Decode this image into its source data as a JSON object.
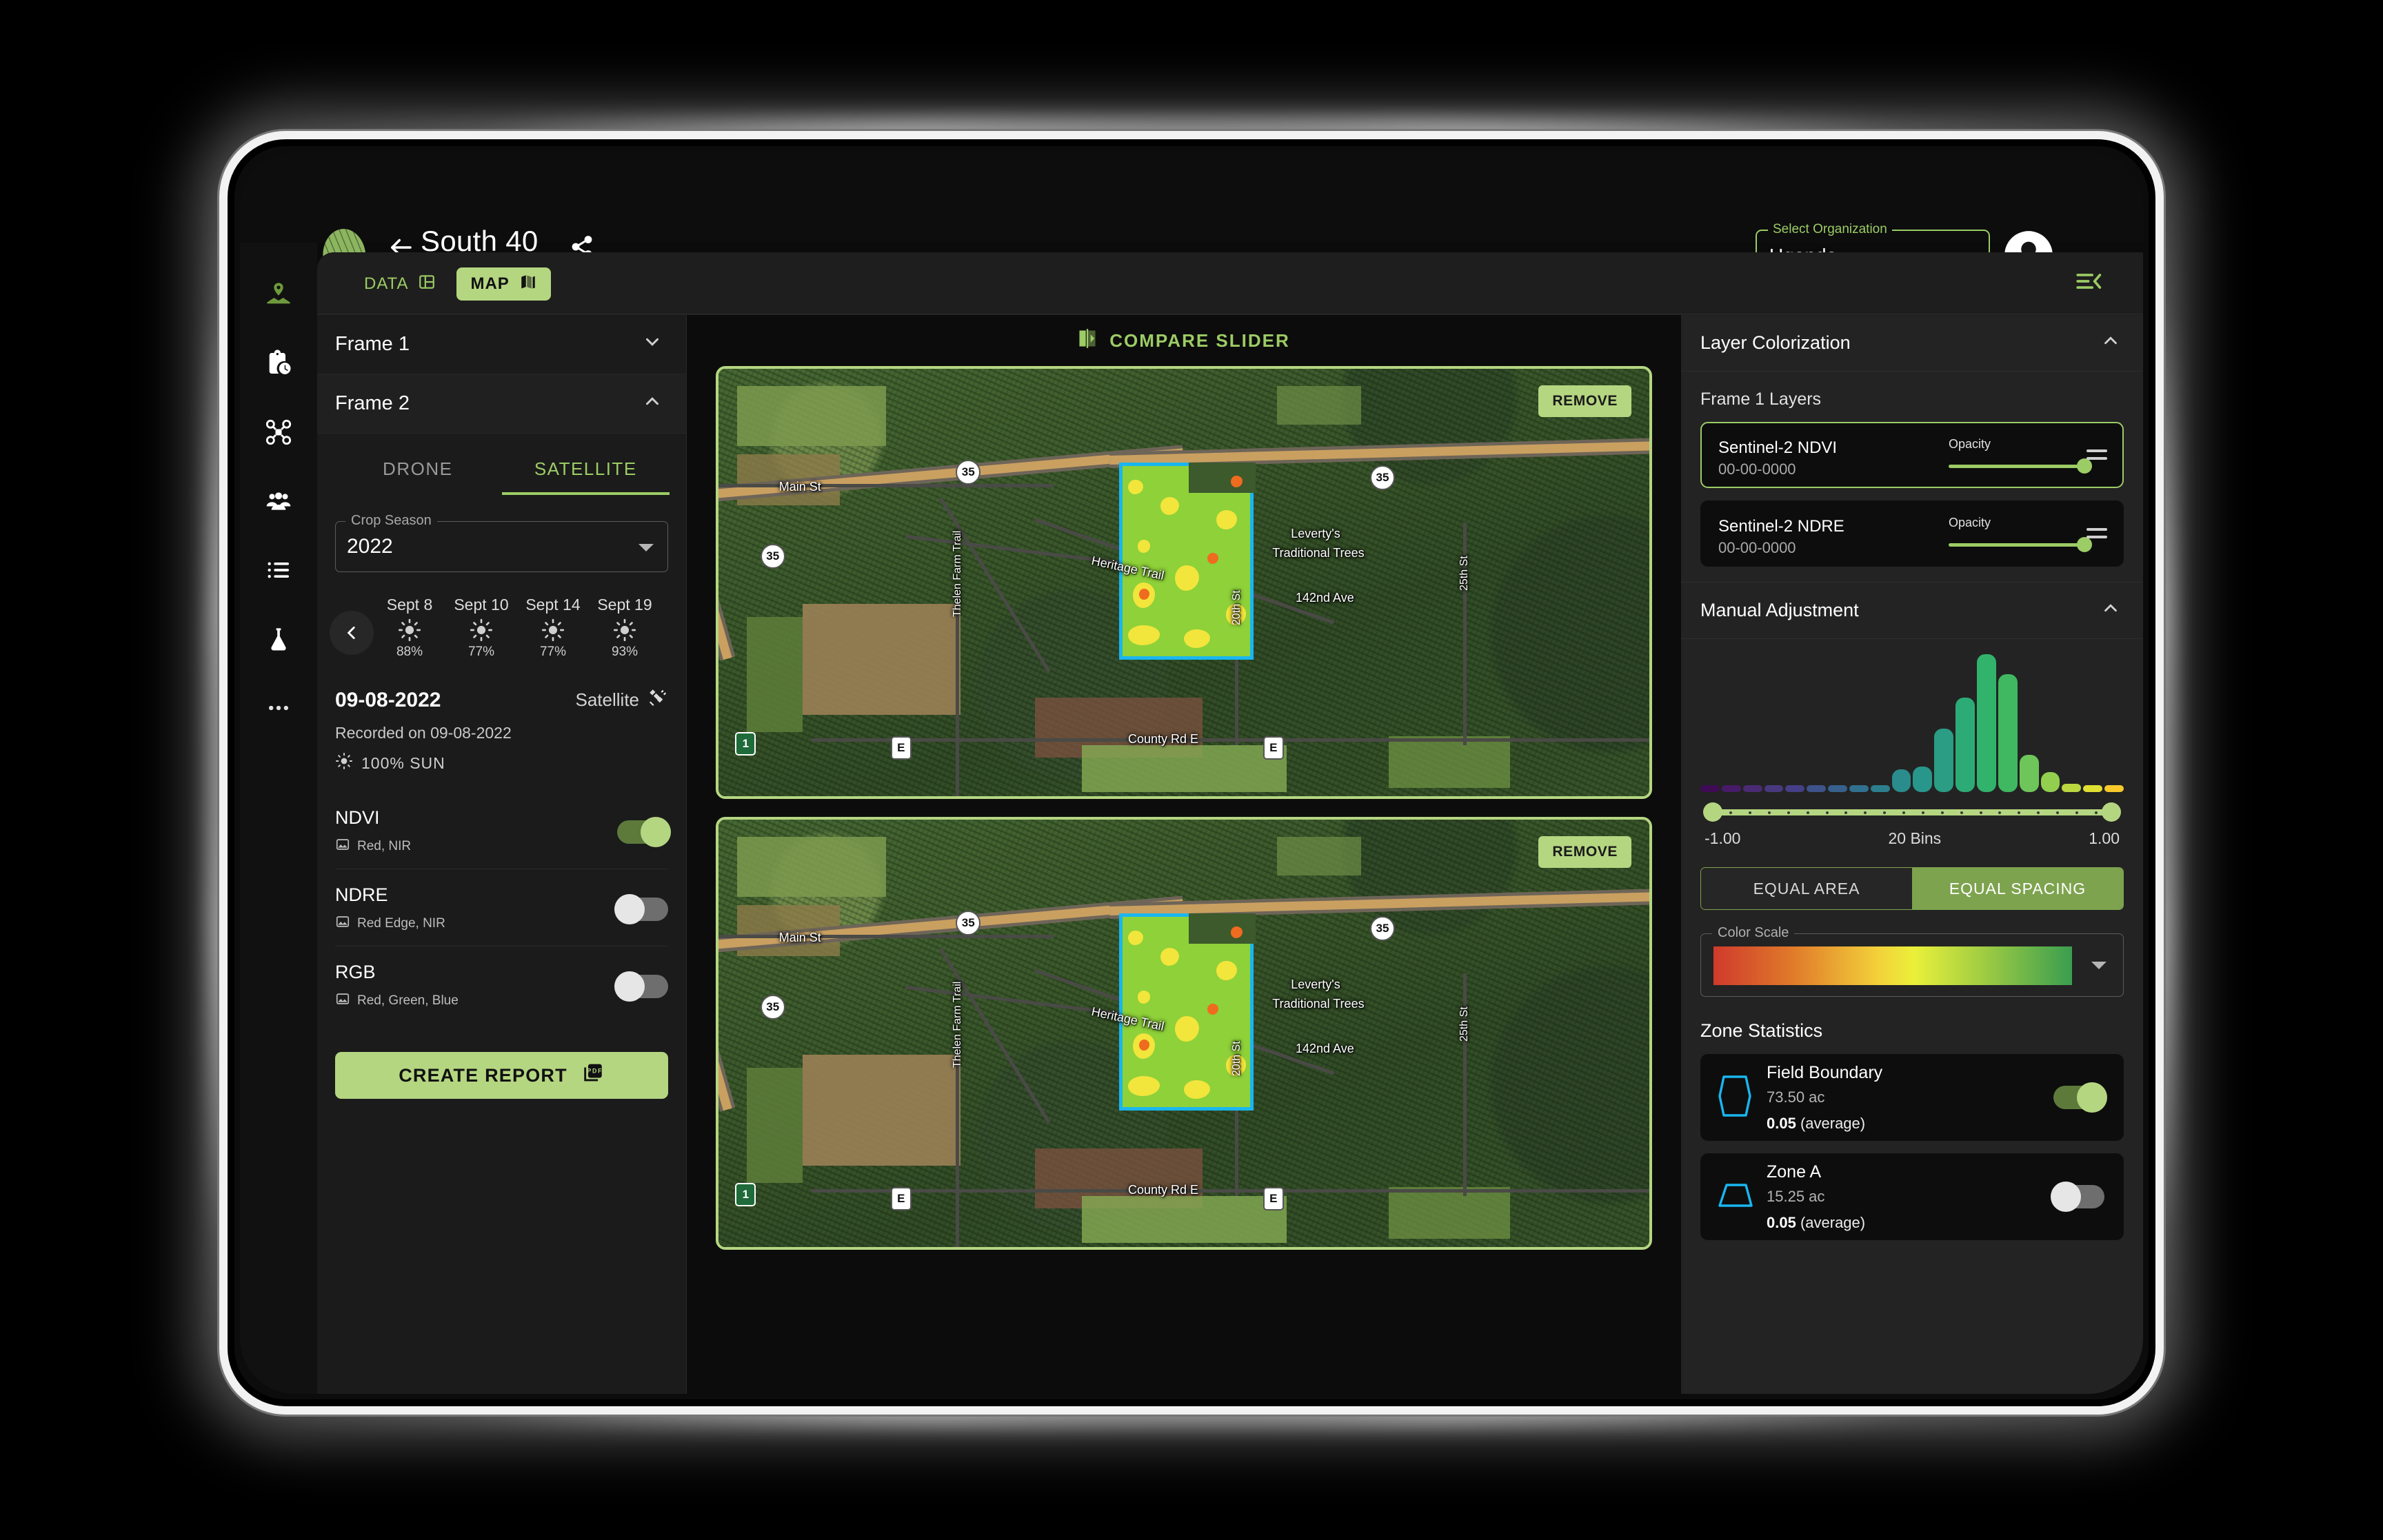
{
  "header": {
    "back_icon": "arrow-left-icon",
    "title": "South 40",
    "share_icon": "share-icon",
    "logo_icon": "leaf-logo-icon",
    "org_label": "Select Organization",
    "org_value": "Uganda",
    "avatar_icon": "account-circle-icon"
  },
  "rail": [
    {
      "icon": "map-pin-field-icon",
      "active": true
    },
    {
      "icon": "clipboard-clock-icon",
      "active": false
    },
    {
      "icon": "drone-icon",
      "active": false
    },
    {
      "icon": "people-group-icon",
      "active": false
    },
    {
      "icon": "list-icon",
      "active": false
    },
    {
      "icon": "flask-icon",
      "active": false
    },
    {
      "icon": "more-horizontal-icon",
      "active": false
    }
  ],
  "toolbar": {
    "data_label": "DATA",
    "data_icon": "panel-layout-icon",
    "map_label": "MAP",
    "map_icon": "map-folded-icon",
    "collapse_icon": "menu-collapse-left-icon"
  },
  "left_panel": {
    "frame1_label": "Frame 1",
    "frame1_chevron": "chevron-down-icon",
    "frame2_label": "Frame 2",
    "frame2_chevron": "chevron-up-icon",
    "tabs": [
      {
        "label": "DRONE",
        "active": false
      },
      {
        "label": "SATELLITE",
        "active": true
      }
    ],
    "crop_season_label": "Crop Season",
    "crop_season_value": "2022",
    "prev_icon": "chevron-left-icon",
    "dates": [
      {
        "label": "Sept 8",
        "icon": "sun-icon",
        "percent": "88%"
      },
      {
        "label": "Sept 10",
        "icon": "sun-icon",
        "percent": "77%"
      },
      {
        "label": "Sept 14",
        "icon": "sun-icon",
        "percent": "77%"
      },
      {
        "label": "Sept 19",
        "icon": "sun-icon",
        "percent": "93%"
      }
    ],
    "capture": {
      "date": "09-08-2022",
      "source": "Satellite",
      "source_icon": "satellite-icon",
      "recorded": "Recorded on 09-08-2022",
      "sun_icon": "sun-icon",
      "sun_text": "100%  SUN"
    },
    "indices": [
      {
        "name": "NDVI",
        "bands": "Red, NIR",
        "bands_icon": "image-icon",
        "on": true
      },
      {
        "name": "NDRE",
        "bands": "Red Edge, NIR",
        "bands_icon": "image-icon",
        "on": false
      },
      {
        "name": "RGB",
        "bands": "Red, Green, Blue",
        "bands_icon": "image-icon",
        "on": false
      }
    ],
    "create_report_label": "CREATE REPORT",
    "create_report_icon": "pdf-icon"
  },
  "center_panel": {
    "compare_title": "COMPARE SLIDER",
    "compare_icon": "compare-slider-icon",
    "maps": [
      {
        "remove_label": "REMOVE"
      },
      {
        "remove_label": "REMOVE"
      }
    ],
    "map_labels_top": [
      "Main St",
      "Heritage Trail",
      "Thelen Farm Trail",
      "Leverty's",
      "Traditional Trees",
      "142nd Ave",
      "20th St",
      "25th St",
      "County Rd E"
    ],
    "map_shields_top": [
      "35",
      "35",
      "35",
      "1",
      "E",
      "E"
    ],
    "map_labels_bottom": [
      "Main St",
      "Heritage Trail",
      "Thelen Farm Trail",
      "Leverty's",
      "Traditional Trees",
      "142nd Ave",
      "20th St",
      "25th St",
      "County Rd E"
    ],
    "map_shields_bottom": [
      "35",
      "35",
      "35",
      "1",
      "E",
      "E"
    ]
  },
  "right_panel": {
    "layer_colorization_title": "Layer Colorization",
    "layer_colorization_chevron": "chevron-up-icon",
    "frame_layers_title": "Frame 1 Layers",
    "layers": [
      {
        "name": "Sentinel-2 NDVI",
        "date": "00-00-0000",
        "opacity_label": "Opacity",
        "opacity": 100,
        "selected": true,
        "drag_icon": "drag-handle-icon"
      },
      {
        "name": "Sentinel-2 NDRE",
        "date": "00-00-0000",
        "opacity_label": "Opacity",
        "opacity": 100,
        "selected": false,
        "drag_icon": "drag-handle-icon"
      }
    ],
    "manual_adjustment_title": "Manual Adjustment",
    "manual_adjustment_chevron": "chevron-up-icon",
    "range_min_label": "-1.00",
    "bins_label": "20 Bins",
    "range_max_label": "1.00",
    "equal_area_label": "EQUAL AREA",
    "equal_spacing_label": "EQUAL SPACING",
    "equal_spacing_active": true,
    "color_scale_label": "Color Scale",
    "color_scale_caret": "chevron-down-icon",
    "zone_statistics_title": "Zone Statistics",
    "zones": [
      {
        "name": "Field Boundary",
        "area": "73.50 ac",
        "avg_value": "0.05",
        "avg_suffix": "(average)",
        "on": true,
        "shape_icon": "field-polygon-icon"
      },
      {
        "name": "Zone A",
        "area": "15.25 ac",
        "avg_value": "0.05",
        "avg_suffix": "(average)",
        "on": false,
        "shape_icon": "zone-trapezoid-icon"
      }
    ]
  },
  "colors": {
    "accent_green": "#9ccc65",
    "button_green": "#b5d681",
    "panel_bg": "#232323",
    "left_bg": "#1b1b1b",
    "card_bg": "#0d0d0d",
    "field_outline": "#19b6f0",
    "field_fill": "#8ed139"
  },
  "chart_data": {
    "type": "bar",
    "title": "Manual Adjustment",
    "xlabel": "20 Bins",
    "ylabel": "",
    "xlim": [
      -1.0,
      1.0
    ],
    "bins": 20,
    "grid": false,
    "legend": null,
    "categories": [
      "-1.00",
      "-0.90",
      "-0.80",
      "-0.70",
      "-0.60",
      "-0.50",
      "-0.40",
      "-0.30",
      "-0.20",
      "-0.10",
      "0.00",
      "0.10",
      "0.20",
      "0.30",
      "0.40",
      "0.50",
      "0.60",
      "0.70",
      "0.80",
      "0.90"
    ],
    "values": [
      1,
      1,
      1,
      1,
      1,
      1,
      1,
      1,
      1,
      8,
      9,
      22,
      33,
      48,
      41,
      13,
      7,
      3,
      2,
      2
    ],
    "bar_colors": [
      "#3f0b55",
      "#461b68",
      "#4a2a74",
      "#48397f",
      "#443f86",
      "#3d5389",
      "#37608d",
      "#31708f",
      "#2d7e8e",
      "#2a8c8c",
      "#29968b",
      "#2a9d84",
      "#2dab76",
      "#32b36c",
      "#3fb861",
      "#6ec55a",
      "#92cf4e",
      "#bbd73f",
      "#e0e033",
      "#f7c92b"
    ],
    "range_selection": {
      "min": -1.0,
      "max": 1.0
    }
  }
}
